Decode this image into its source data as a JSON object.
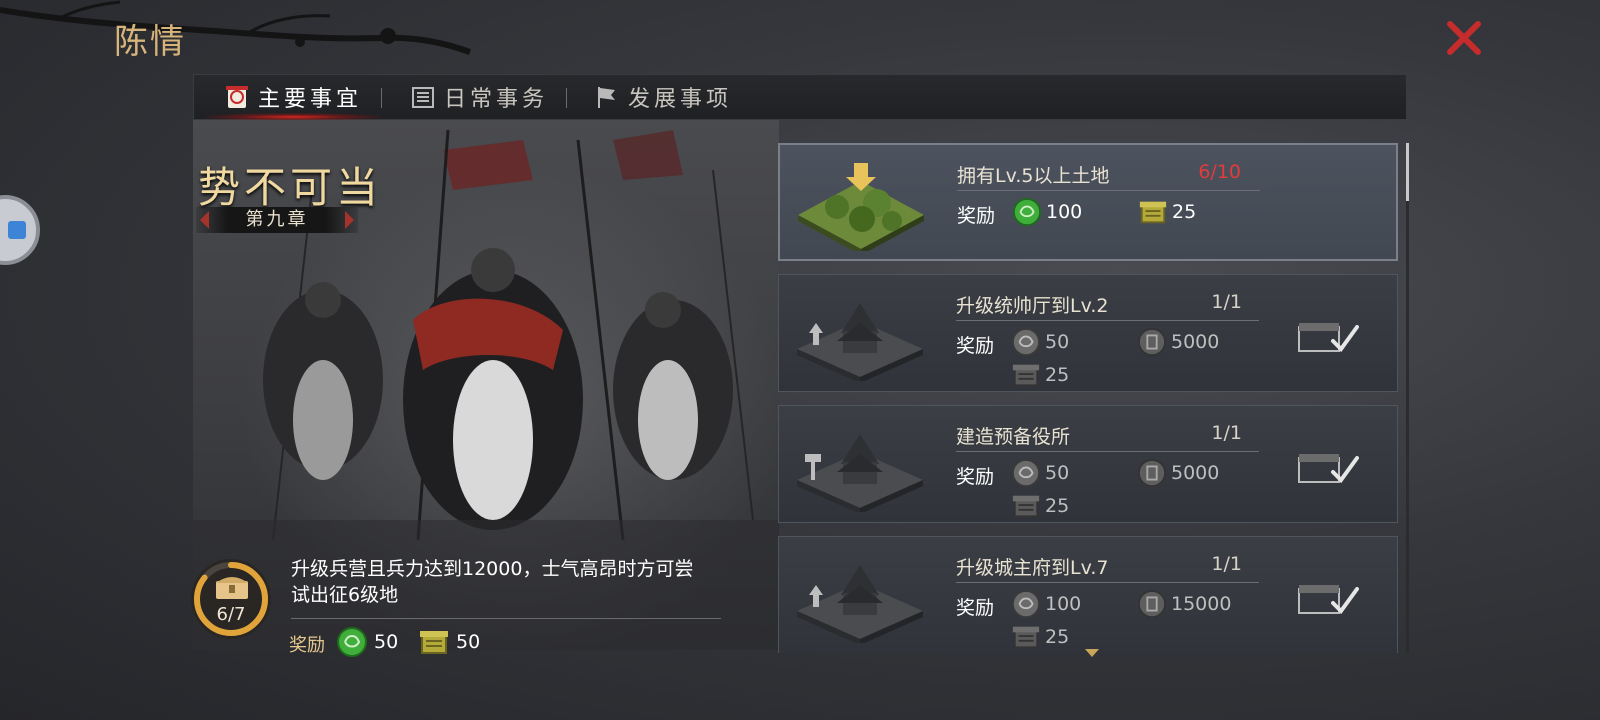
{
  "header": {
    "title": "陈情",
    "close_icon": "close-icon",
    "accent": "#c62c2c"
  },
  "tabs": [
    {
      "label": "主要事宜",
      "icon": "scroll-seal-icon",
      "active": true
    },
    {
      "label": "日常事务",
      "icon": "ledger-icon",
      "active": false
    },
    {
      "label": "发展事项",
      "icon": "flag-icon",
      "active": false
    }
  ],
  "chapter": {
    "title": "势不可当",
    "subtitle": "第九章",
    "progress_text": "6/7",
    "progress_fraction": 0.857,
    "goal": "升级兵营且兵力达到12000，士气高昂时方可尝试出征6级地",
    "reward_label": "奖励",
    "rewards": [
      {
        "icon": "jade-coin-icon",
        "value": "50"
      },
      {
        "icon": "grain-chest-icon",
        "value": "50"
      }
    ]
  },
  "quests": [
    {
      "title": "拥有Lv.5以上土地",
      "progress": "6/10",
      "reward_label": "奖励",
      "rewards": [
        {
          "icon": "jade-coin-icon",
          "value": "100"
        },
        {
          "icon": "grain-chest-icon",
          "value": "25"
        }
      ],
      "status": "in-progress"
    },
    {
      "title": "升级统帅厅到Lv.2",
      "progress": "1/1",
      "reward_label": "奖励",
      "rewards": [
        {
          "icon": "copper-coin-icon",
          "value": "50"
        },
        {
          "icon": "silver-coin-icon",
          "value": "5000"
        },
        {
          "icon": "grain-chest-icon",
          "value": "25"
        }
      ],
      "status": "claimed"
    },
    {
      "title": "建造预备役所",
      "progress": "1/1",
      "reward_label": "奖励",
      "rewards": [
        {
          "icon": "copper-coin-icon",
          "value": "50"
        },
        {
          "icon": "silver-coin-icon",
          "value": "5000"
        },
        {
          "icon": "grain-chest-icon",
          "value": "25"
        }
      ],
      "status": "claimed"
    },
    {
      "title": "升级城主府到Lv.7",
      "progress": "1/1",
      "reward_label": "奖励",
      "rewards": [
        {
          "icon": "copper-coin-icon",
          "value": "100"
        },
        {
          "icon": "silver-coin-icon",
          "value": "15000"
        },
        {
          "icon": "grain-chest-icon",
          "value": "25"
        }
      ],
      "status": "claimed"
    }
  ]
}
